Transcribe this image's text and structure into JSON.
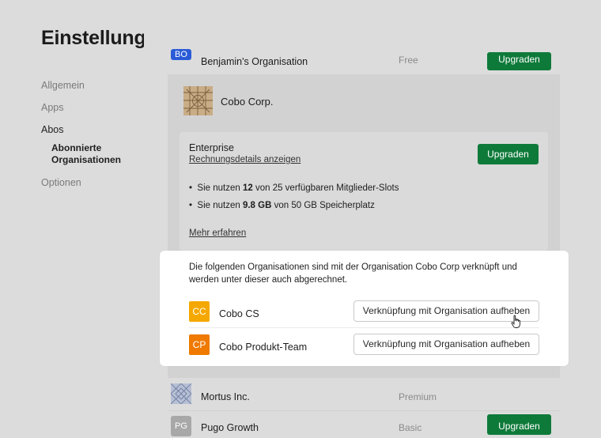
{
  "page": {
    "title": "Einstellungen"
  },
  "nav": {
    "items": [
      {
        "label": "Allgemein",
        "active": false
      },
      {
        "label": "Apps",
        "active": false
      },
      {
        "label": "Abos",
        "active": true
      },
      {
        "label": "Abonnierte Organisationen",
        "active": true,
        "sub": true
      },
      {
        "label": "Optionen",
        "active": false
      }
    ]
  },
  "orgs": {
    "top": {
      "initials": "BO",
      "name": "Benjamin's Organisation",
      "plan": "Free",
      "button": "Upgraden",
      "icon_color": "#2a5bd7"
    },
    "cobo": {
      "name": "Cobo Corp.",
      "plan_title": "Enterprise",
      "billing_link": "Rechnungsdetails anzeigen",
      "upgrade_button": "Upgraden",
      "usage": [
        {
          "prefix": "Sie nutzen ",
          "value": "12",
          "suffix": " von 25 verfügbaren Mitglieder-Slots"
        },
        {
          "prefix": "Sie nutzen ",
          "value": "9.8 GB",
          "suffix": " von 50 GB Speicherplatz"
        }
      ],
      "learn_more": "Mehr erfahren"
    },
    "mortus": {
      "name": "Mortus Inc.",
      "plan": "Premium"
    },
    "pugo": {
      "initials": "PG",
      "name": "Pugo Growth",
      "plan": "Basic",
      "button": "Upgraden",
      "icon_color": "#a8a8a8"
    }
  },
  "linked": {
    "description": "Die folgenden Organisationen sind mit der Organisation Cobo Corp verknüpft und werden unter dieser auch abgerechnet.",
    "rows": [
      {
        "initials": "CC",
        "name": "Cobo CS",
        "button": "Verknüpfung mit Organisation aufheben",
        "color": "#f5a800"
      },
      {
        "initials": "CP",
        "name": "Cobo Produkt-Team",
        "button": "Verknüpfung mit Organisation aufheben",
        "color": "#f07a00"
      }
    ]
  },
  "colors": {
    "accent_green": "#0e7a3a",
    "background": "#dcdcdc",
    "panel": "#ffffff"
  }
}
